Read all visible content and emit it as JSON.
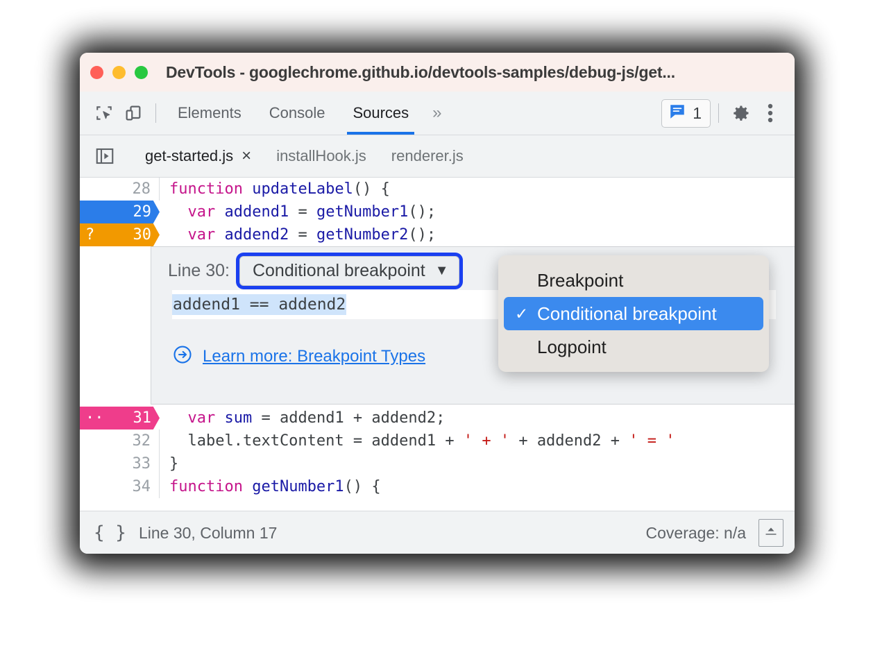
{
  "window": {
    "title": "DevTools - googlechrome.github.io/devtools-samples/debug-js/get...",
    "traffic_lights": [
      "close-red",
      "minimize-yellow",
      "maximize-green"
    ]
  },
  "toolbar": {
    "inspect_icon": "inspect-element-icon",
    "device_icon": "device-toolbar-icon",
    "panels": [
      {
        "label": "Elements",
        "active": false
      },
      {
        "label": "Console",
        "active": false
      },
      {
        "label": "Sources",
        "active": true
      }
    ],
    "overflow_label": "»",
    "messages_count": "1",
    "message_icon": "message-bubble-icon",
    "settings_icon": "gear-icon",
    "more_icon": "kebab-menu-icon",
    "accent_color": "#1a73e8"
  },
  "filetabs": {
    "nav_toggle_icon": "show-navigator-icon",
    "tabs": [
      {
        "label": "get-started.js",
        "active": true,
        "close": "×"
      },
      {
        "label": "installHook.js",
        "active": false
      },
      {
        "label": "renderer.js",
        "active": false
      }
    ]
  },
  "editor": {
    "lines_top": [
      {
        "number": "28",
        "marker": "none",
        "tokens": [
          {
            "t": "function ",
            "c": "kw"
          },
          {
            "t": "updateLabel",
            "c": "var"
          },
          {
            "t": "() {",
            "c": "plain"
          }
        ]
      },
      {
        "number": "29",
        "marker": "blue",
        "marker_glyph": "",
        "tokens": [
          {
            "t": "  ",
            "c": "plain"
          },
          {
            "t": "var ",
            "c": "kw"
          },
          {
            "t": "addend1",
            "c": "var"
          },
          {
            "t": " = ",
            "c": "plain"
          },
          {
            "t": "getNumber1",
            "c": "var"
          },
          {
            "t": "();",
            "c": "plain"
          }
        ]
      },
      {
        "number": "30",
        "marker": "orange",
        "marker_glyph": "?",
        "tokens": [
          {
            "t": "  ",
            "c": "plain"
          },
          {
            "t": "var ",
            "c": "kw"
          },
          {
            "t": "addend2",
            "c": "var"
          },
          {
            "t": " = ",
            "c": "plain"
          },
          {
            "t": "getNumber2",
            "c": "var"
          },
          {
            "t": "();",
            "c": "plain"
          }
        ]
      }
    ],
    "lines_bottom": [
      {
        "number": "31",
        "marker": "pink",
        "marker_glyph": "··",
        "tokens": [
          {
            "t": "  ",
            "c": "plain"
          },
          {
            "t": "var ",
            "c": "kw"
          },
          {
            "t": "sum",
            "c": "var"
          },
          {
            "t": " = addend1 + addend2;",
            "c": "plain"
          }
        ]
      },
      {
        "number": "32",
        "marker": "none",
        "tokens": [
          {
            "t": "  label.textContent = addend1 + ",
            "c": "plain"
          },
          {
            "t": "' + '",
            "c": "str"
          },
          {
            "t": " + addend2 + ",
            "c": "plain"
          },
          {
            "t": "' = '",
            "c": "str"
          }
        ]
      },
      {
        "number": "33",
        "marker": "none",
        "tokens": [
          {
            "t": "}",
            "c": "plain"
          }
        ]
      },
      {
        "number": "34",
        "marker": "none",
        "tokens": [
          {
            "t": "function ",
            "c": "kw"
          },
          {
            "t": "getNumber1",
            "c": "var"
          },
          {
            "t": "() {",
            "c": "plain"
          }
        ]
      }
    ]
  },
  "breakpoint_editor": {
    "line_label": "Line 30:",
    "selected_type": "Conditional breakpoint",
    "caret": "▼",
    "condition_value": "addend1 == addend2",
    "learn_more_icon": "arrow-circle-right-icon",
    "learn_more_label": "Learn more: Breakpoint Types",
    "highlight_ring_color": "#1a40f0"
  },
  "dropdown": {
    "items": [
      {
        "label": "Breakpoint",
        "selected": false,
        "check": ""
      },
      {
        "label": "Conditional breakpoint",
        "selected": true,
        "check": "✓"
      },
      {
        "label": "Logpoint",
        "selected": false,
        "check": ""
      }
    ],
    "selected_bg": "#3b8aee"
  },
  "statusbar": {
    "format_icon": "pretty-print-braces-icon",
    "position": "Line 30, Column 17",
    "coverage": "Coverage: n/a",
    "drawer_icon": "show-drawer-icon"
  }
}
